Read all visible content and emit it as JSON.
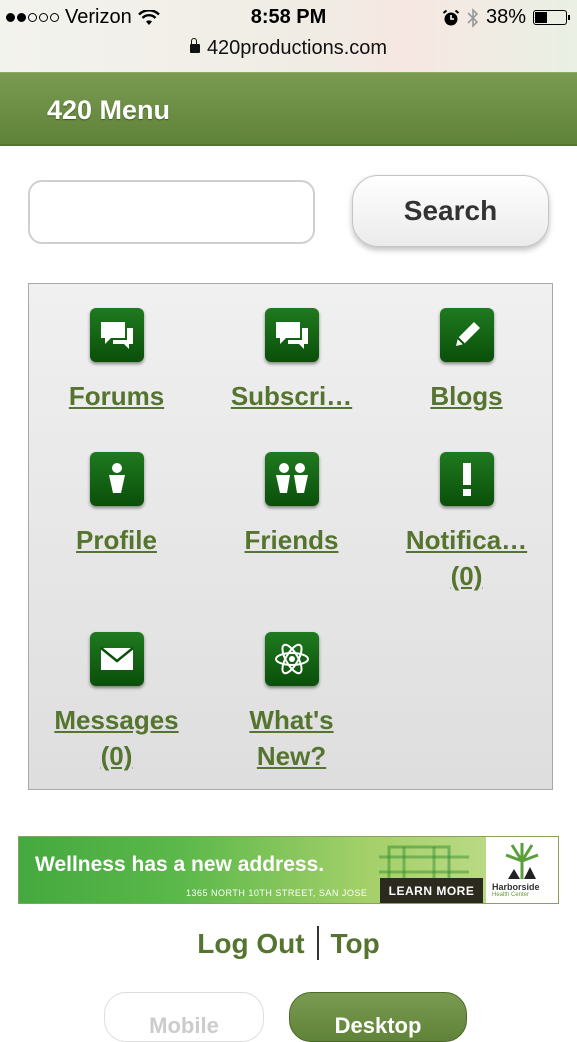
{
  "status_bar": {
    "carrier": "Verizon",
    "time": "8:58 PM",
    "battery": "38%",
    "battery_level": 0.38
  },
  "url": "420productions.com",
  "menu_bar": {
    "title": "420 Menu"
  },
  "search": {
    "value": "",
    "button_label": "Search"
  },
  "grid_items": [
    {
      "label": "Forums",
      "icon": "forum-icon"
    },
    {
      "label": "Subscri…",
      "icon": "subscriptions-icon"
    },
    {
      "label": "Blogs",
      "icon": "pencil-icon"
    },
    {
      "label": "Profile",
      "icon": "person-icon"
    },
    {
      "label": "Friends",
      "icon": "friends-icon"
    },
    {
      "label": "Notifica…",
      "count": "(0)",
      "icon": "exclamation-icon"
    },
    {
      "label": "Messages",
      "count": "(0)",
      "icon": "envelope-icon"
    },
    {
      "label": "What's",
      "label2": "New?",
      "icon": "atom-icon"
    }
  ],
  "banner": {
    "headline": "Wellness has a new address.",
    "address": "1365 NORTH 10TH STREET, SAN JOSE",
    "button": "LEARN MORE",
    "logo_name": "Harborside",
    "logo_sub": "Health Center"
  },
  "footer": {
    "logout": "Log Out",
    "top": "Top"
  },
  "view_mode": {
    "mobile": "Mobile",
    "desktop": "Desktop",
    "selected": "Desktop"
  },
  "colors": {
    "accent": "#5f8338",
    "link": "#55742f",
    "icon_bg": "#0a4f0a"
  }
}
